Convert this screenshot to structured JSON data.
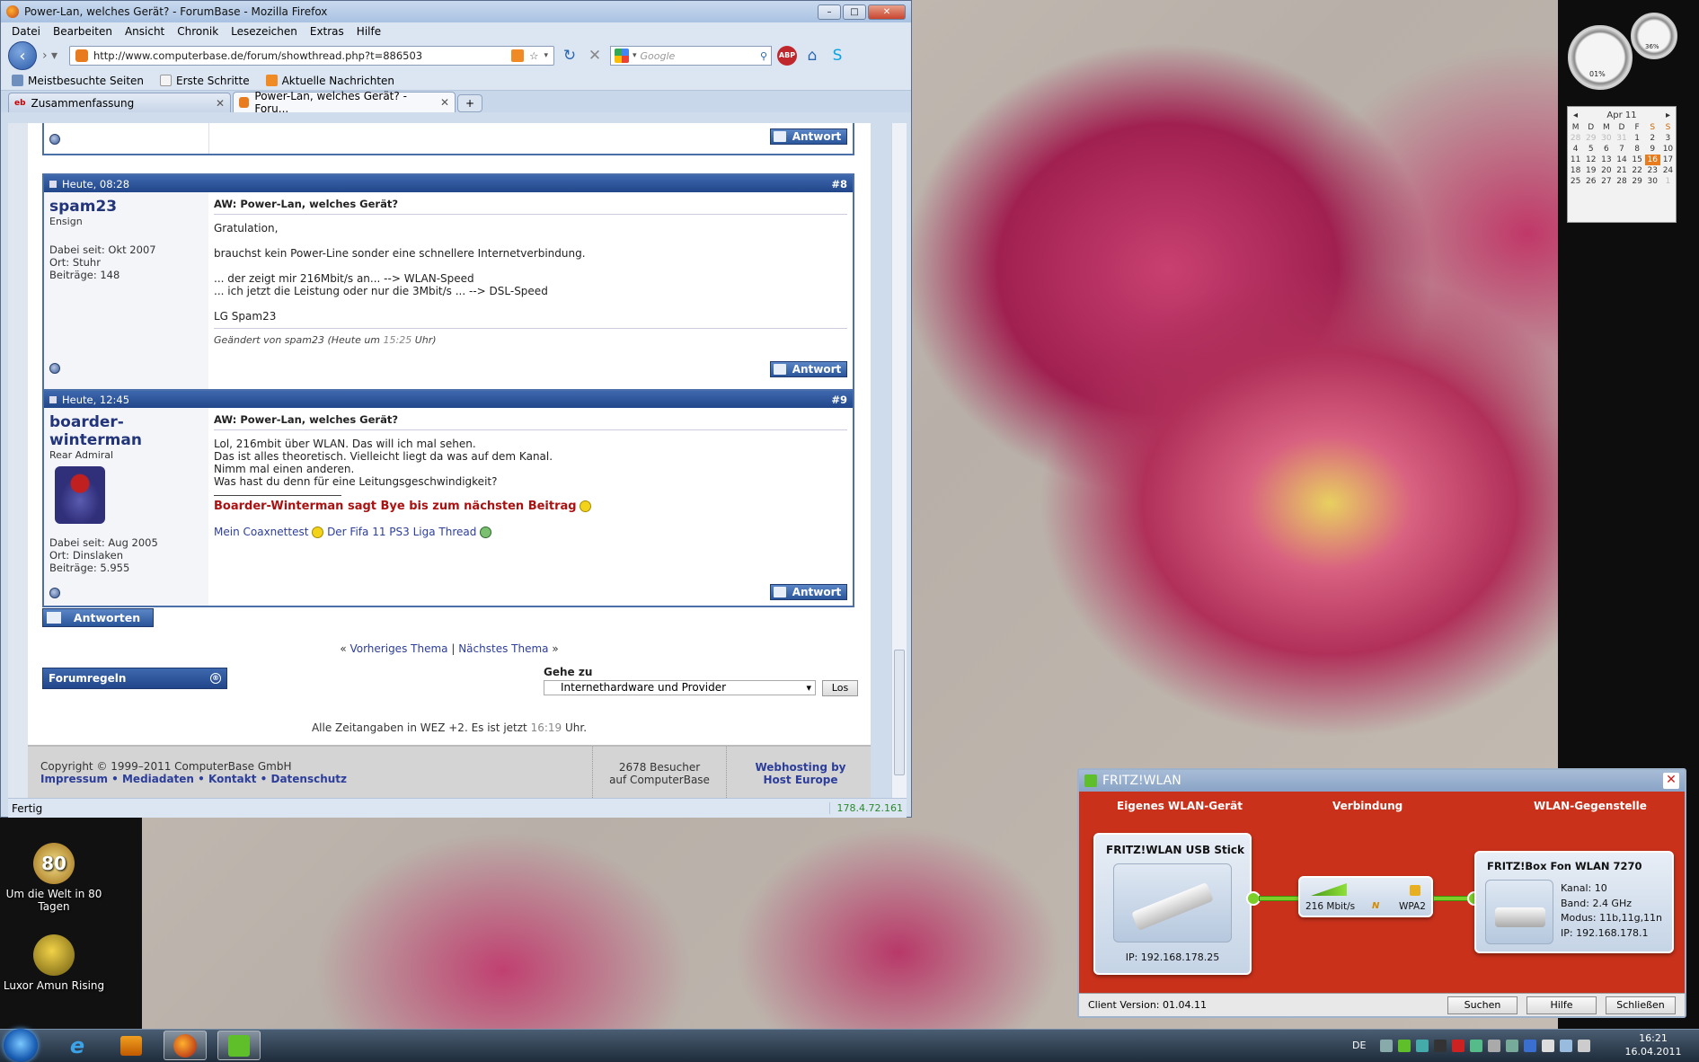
{
  "browser": {
    "title": "Power-Lan, welches Gerät? - ForumBase - Mozilla Firefox",
    "menu": [
      "Datei",
      "Bearbeiten",
      "Ansicht",
      "Chronik",
      "Lesezeichen",
      "Extras",
      "Hilfe"
    ],
    "url": "http://www.computerbase.de/forum/showthread.php?t=886503",
    "search_placeholder": "Google",
    "abp": "ABP",
    "bookmarks": [
      "Meistbesuchte Seiten",
      "Erste Schritte",
      "Aktuelle Nachrichten"
    ],
    "tabs": [
      {
        "label": "Zusammenfassung",
        "active": false
      },
      {
        "label": "Power-Lan, welches Gerät? - Foru...",
        "active": true
      }
    ],
    "newtab": "+",
    "status": "Fertig",
    "status_ip": "178.4.72.161"
  },
  "forum": {
    "reply_label": "Antwort",
    "posts": [
      {
        "date": "Heute, 08:28",
        "number": "#8",
        "username": "spam23",
        "rank": "Ensign",
        "meta": [
          "Dabei seit: Okt 2007",
          "Ort: Stuhr",
          "Beiträge: 148"
        ],
        "subject": "AW: Power-Lan, welches Gerät?",
        "lines": [
          "Gratulation,",
          "brauchst kein Power-Line sonder eine schnellere Internetverbindung.",
          "... der zeigt mir 216Mbit/s an... --> WLAN-Speed",
          "... ich jetzt die Leistung oder nur die 3Mbit/s ... --> DSL-Speed",
          "LG Spam23"
        ],
        "edited_prefix": "Geändert von spam23 (Heute um ",
        "edited_time": "15:25",
        "edited_suffix": " Uhr)"
      },
      {
        "date": "Heute, 12:45",
        "number": "#9",
        "username": "boarder-winterman",
        "rank": "Rear Admiral",
        "meta": [
          "Dabei seit: Aug 2005",
          "Ort: Dinslaken",
          "Beiträge: 5.955"
        ],
        "subject": "AW: Power-Lan, welches Gerät?",
        "lines": [
          "Lol, 216mbit über WLAN. Das will ich mal sehen.",
          "Das ist alles theoretisch. Vielleicht liegt da was auf dem Kanal.",
          "Nimm mal einen anderen.",
          "Was hast du denn für eine Leitungsgeschwindigkeit?"
        ],
        "signature": "Boarder-Winterman sagt Bye bis zum nächsten Beitrag",
        "links": [
          "Mein Coaxnettest",
          "Der Fifa 11 PS3 Liga Thread"
        ]
      }
    ],
    "antworten": "Antworten",
    "prev_thread": "Vorheriges Thema",
    "next_thread": "Nächstes Thema",
    "separator": "|",
    "forumregeln": "Forumregeln",
    "gehe_zu": "Gehe zu",
    "gehe_select": "Internethardware und Provider",
    "los": "Los",
    "zeit_prefix": "Alle Zeitangaben in WEZ +2. Es ist jetzt ",
    "zeit_time": "16:19",
    "zeit_suffix": " Uhr.",
    "copyright": "Copyright © 1999–2011 ComputerBase GmbH",
    "footer_links": [
      "Impressum",
      "Mediadaten",
      "Kontakt",
      "Datenschutz"
    ],
    "visitors": "2678 Besucher",
    "visitors_sub": "auf ComputerBase",
    "hosting": "Webhosting by",
    "hosting_sub": "Host Europe"
  },
  "desktop": {
    "icons": [
      {
        "label": "Um die Welt in 80 Tagen",
        "badge": "80"
      },
      {
        "label": "Luxor Amun Rising"
      }
    ],
    "gauge_values": [
      "01%",
      "36%"
    ],
    "calendar": {
      "month": "Apr 11",
      "days_header": [
        "M",
        "D",
        "M",
        "D",
        "F",
        "S",
        "S"
      ],
      "weeks": [
        [
          "28",
          "29",
          "30",
          "31",
          "1",
          "2",
          "3"
        ],
        [
          "4",
          "5",
          "6",
          "7",
          "8",
          "9",
          "10"
        ],
        [
          "11",
          "12",
          "13",
          "14",
          "15",
          "16",
          "17"
        ],
        [
          "18",
          "19",
          "20",
          "21",
          "22",
          "23",
          "24"
        ],
        [
          "25",
          "26",
          "27",
          "28",
          "29",
          "30",
          "1"
        ]
      ],
      "today": "16"
    }
  },
  "fritz": {
    "title": "FRITZ!WLAN",
    "head_local": "Eigenes WLAN-Gerät",
    "head_conn": "Verbindung",
    "head_remote": "WLAN-Gegenstelle",
    "local_name": "FRITZ!WLAN USB Stick",
    "local_ip": "IP: 192.168.178.25",
    "speed": "216 Mbit/s",
    "mode_letter": "N",
    "security": "WPA2",
    "remote_name": "FRITZ!Box Fon WLAN 7270",
    "remote_info": [
      "Kanal: 10",
      "Band: 2.4 GHz",
      "Modus: 11b,11g,11n",
      "IP: 192.168.178.1"
    ],
    "client_version": "Client Version: 01.04.11",
    "buttons": [
      "Suchen",
      "Hilfe",
      "Schließen"
    ]
  },
  "taskbar": {
    "lang": "DE",
    "time": "16:21",
    "date": "16.04.2011"
  }
}
